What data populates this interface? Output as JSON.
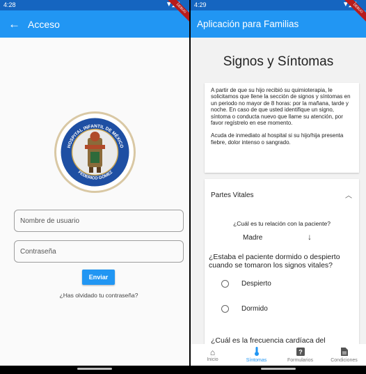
{
  "left_screen": {
    "status_time": "4:28",
    "status_icons": "▼◢▮",
    "debug_label": "DEBUG",
    "app_bar_title": "Acceso",
    "logo": {
      "ring_top": "HOSPITAL INFANTIL DE MÉXICO",
      "ring_inner": "INSTITUTO NACIONAL DE SALUD",
      "ring_bottom": "FEDERICO GÓMEZ"
    },
    "username_placeholder": "Nombre de usuario",
    "password_placeholder": "Contraseña",
    "submit_label": "Enviar",
    "forgot_link": "¿Has olvidado tu contraseña?"
  },
  "right_screen": {
    "status_time": "4:29",
    "status_icons": "▼◢▮",
    "debug_label": "DEBUG",
    "app_bar_title": "Aplicación para Familias",
    "page_title": "Signos y Síntomas",
    "info_paragraph_1": "A partir de que su hijo recibió su quimioterapia, le solicitamos que llene la sección de signos y síntomas en un periodo no mayor de 8 horas: por la mañana, tarde y noche. En caso de que usted identifique un signo, síntoma o conducta nuevo que llame su atención, por favor regístrelo en ese momento.",
    "info_paragraph_2": "Acuda de inmediato al hospital si su hijo/hija presenta fiebre, dolor intenso o sangrado.",
    "section_header": "Partes Vitales",
    "relation_question": "¿Cuál es tu relación con la paciente?",
    "relation_value": "Madre",
    "sleep_question": "¿Estaba el paciente dormido o despierto cuando se tomaron los signos vitales?",
    "options": [
      "Despierto",
      "Dormido"
    ],
    "next_question": "¿Cuál es la frecuencia cardíaca del",
    "nav": [
      {
        "label": "Inicio",
        "icon": "home-icon",
        "glyph": "⌂"
      },
      {
        "label": "Síntomas",
        "icon": "thermometer-icon",
        "glyph": "🌡"
      },
      {
        "label": "Formularios",
        "icon": "form-icon",
        "glyph": "❓"
      },
      {
        "label": "Condiciones",
        "icon": "document-icon",
        "glyph": "📄"
      }
    ],
    "active_tab": "Síntomas",
    "colors": {
      "primary": "#2196f3",
      "status": "#1565c0"
    }
  }
}
